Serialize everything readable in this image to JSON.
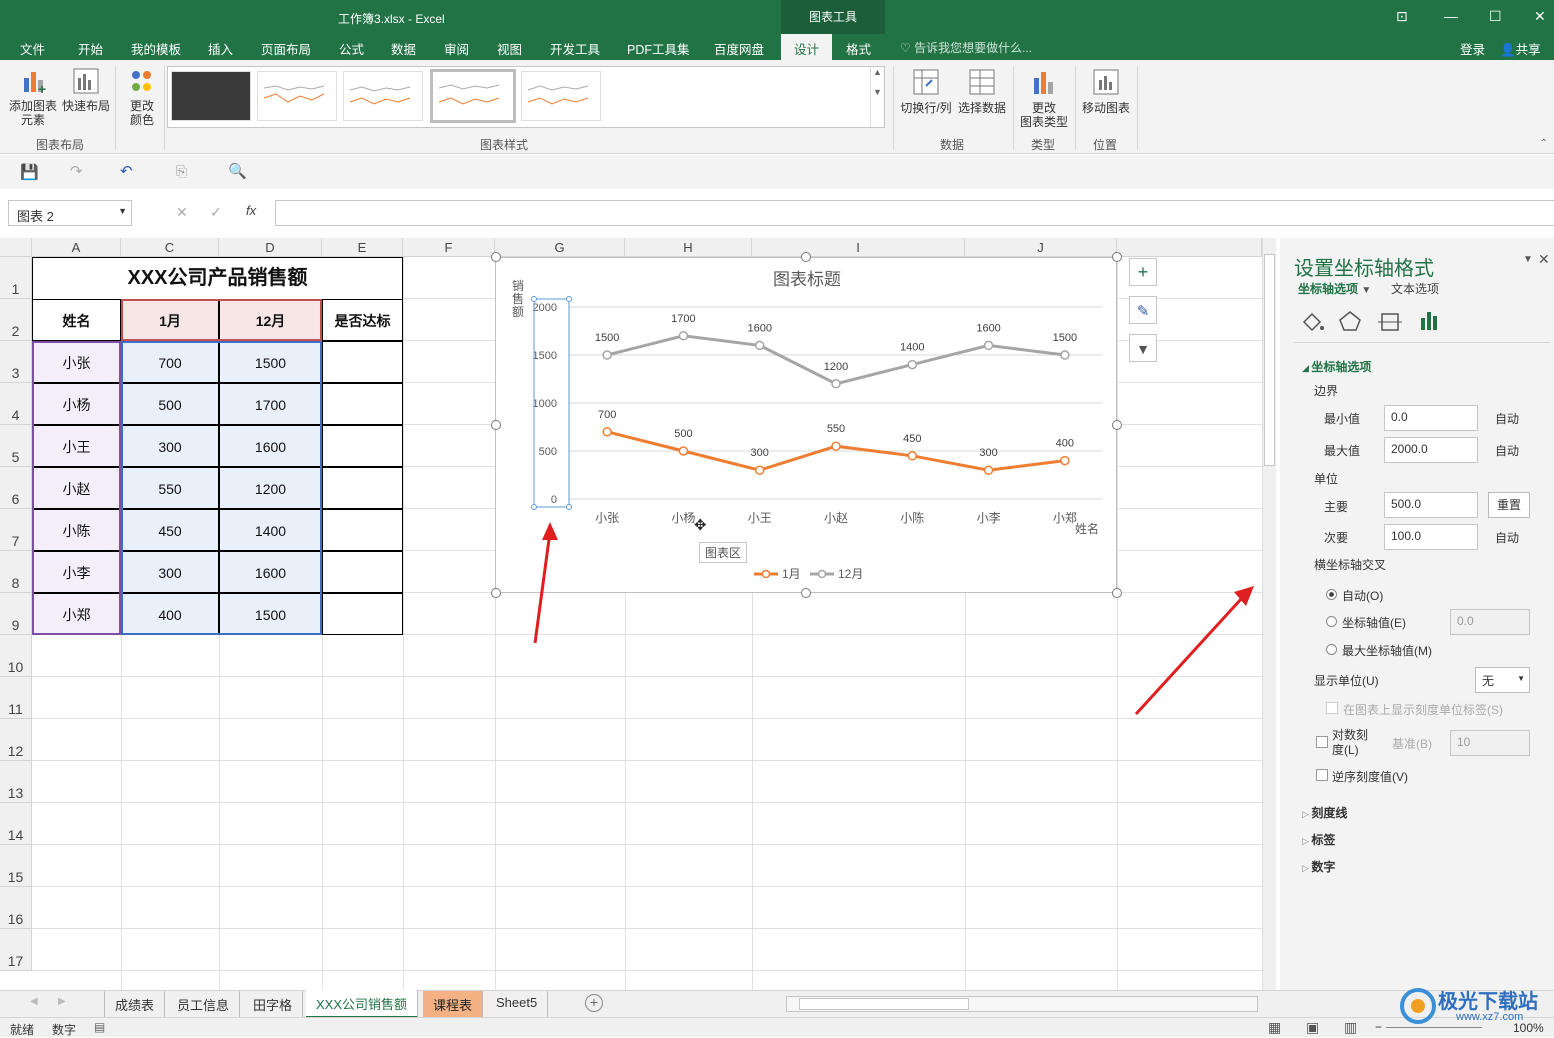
{
  "window": {
    "title": "工作簿3.xlsx - Excel",
    "context_tab": "图表工具"
  },
  "menu": {
    "tabs": [
      "文件",
      "开始",
      "我的模板",
      "插入",
      "页面布局",
      "公式",
      "数据",
      "审阅",
      "视图",
      "开发工具",
      "PDF工具集",
      "百度网盘",
      "设计",
      "格式"
    ],
    "active": "设计",
    "tell_me": "告诉我您想要做什么...",
    "login": "登录",
    "share": "共享"
  },
  "ribbon": {
    "add_element": [
      "添加图表",
      "元素"
    ],
    "quick_layout": "快速布局",
    "change_color": [
      "更改",
      "颜色"
    ],
    "group_layout": "图表布局",
    "group_styles": "图表样式",
    "switch_rowcol": "切换行/列",
    "select_data": "选择数据",
    "group_data": "数据",
    "change_type": [
      "更改",
      "图表类型"
    ],
    "group_type": "类型",
    "move_chart": "移动图表",
    "group_location": "位置"
  },
  "formula_bar": {
    "name_box": "图表 2",
    "fx": "fx"
  },
  "columns": [
    "A",
    "C",
    "D",
    "E",
    "F",
    "G",
    "H",
    "I",
    "J"
  ],
  "rows": [
    "1",
    "2",
    "3",
    "4",
    "5",
    "6",
    "7",
    "8",
    "9",
    "10",
    "11",
    "12",
    "13",
    "14",
    "15",
    "16",
    "17"
  ],
  "table": {
    "title": "XXX公司产品销售额",
    "headers": [
      "姓名",
      "1月",
      "12月",
      "是否达标"
    ],
    "rows": [
      [
        "小张",
        "700",
        "1500"
      ],
      [
        "小杨",
        "500",
        "1700"
      ],
      [
        "小王",
        "300",
        "1600"
      ],
      [
        "小赵",
        "550",
        "1200"
      ],
      [
        "小陈",
        "450",
        "1400"
      ],
      [
        "小李",
        "300",
        "1600"
      ],
      [
        "小郑",
        "400",
        "1500"
      ]
    ]
  },
  "chart_data": {
    "type": "line",
    "title": "图表标题",
    "ylabel": "销售额",
    "xlabel": "姓名",
    "categories": [
      "小张",
      "小杨",
      "小王",
      "小赵",
      "小陈",
      "小李",
      "小郑"
    ],
    "series": [
      {
        "name": "1月",
        "values": [
          700,
          500,
          300,
          550,
          450,
          300,
          400
        ],
        "color": "#ed7d31"
      },
      {
        "name": "12月",
        "values": [
          1500,
          1700,
          1600,
          1200,
          1400,
          1600,
          1500
        ],
        "color": "#a5a5a5"
      }
    ],
    "ylim": [
      0,
      2000
    ],
    "yticks": [
      "0",
      "500",
      "1000",
      "1500",
      "2000"
    ],
    "legend": "bottom",
    "grid": true,
    "tooltip": "图表区"
  },
  "panel": {
    "title": "设置坐标轴格式",
    "tab_axis": "坐标轴选项",
    "tab_text": "文本选项",
    "section": "坐标轴选项",
    "bounds": "边界",
    "min_label": "最小值",
    "min_value": "0.0",
    "min_auto": "自动",
    "max_label": "最大值",
    "max_value": "2000.0",
    "max_auto": "自动",
    "units": "单位",
    "major_label": "主要",
    "major_value": "500.0",
    "reset": "重置",
    "minor_label": "次要",
    "minor_value": "100.0",
    "minor_auto": "自动",
    "cross": "横坐标轴交叉",
    "opt_auto": "自动(O)",
    "opt_value": "坐标轴值(E)",
    "opt_value_input": "0.0",
    "opt_max": "最大坐标轴值(M)",
    "display_units": "显示单位(U)",
    "display_units_value": "无",
    "show_units_label": "在图表上显示刻度单位标签(S)",
    "log_scale": "对数刻度(L)",
    "base_label": "基准(B)",
    "base_value": "10",
    "reverse": "逆序刻度值(V)",
    "collapsed": [
      "刻度线",
      "标签",
      "数字"
    ]
  },
  "sheets": {
    "tabs": [
      "成绩表",
      "员工信息",
      "田字格",
      "XXX公司销售额",
      "课程表",
      "Sheet5"
    ],
    "active": "XXX公司销售额"
  },
  "status": {
    "ready": "就绪",
    "mode": "数字",
    "zoom": "100%"
  },
  "watermark": {
    "brand": "极光下载站",
    "url": "www.xz7.com"
  }
}
